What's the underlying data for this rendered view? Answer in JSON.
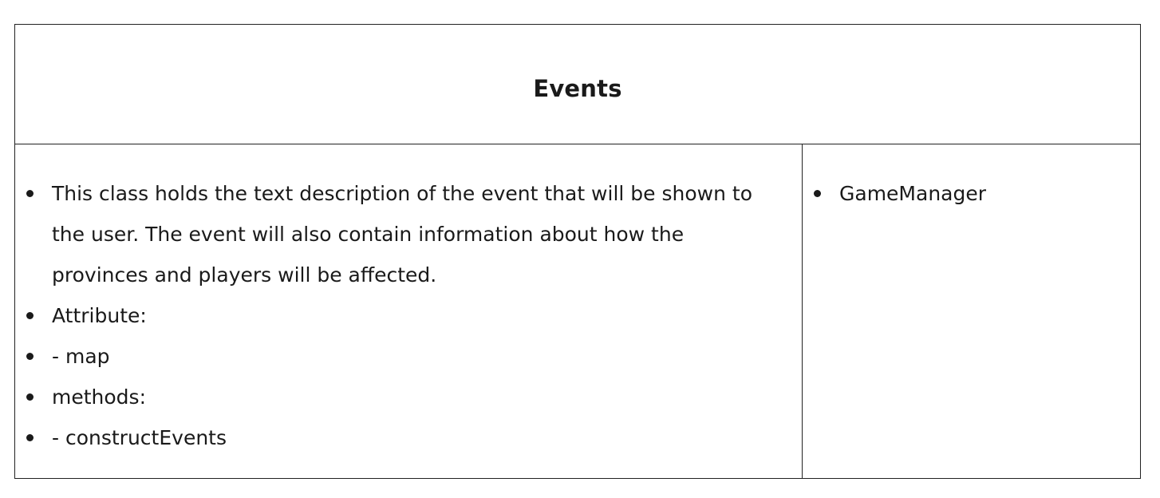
{
  "card": {
    "title": "Events",
    "responsibilities": [
      "This class holds the text description of the event that will be shown to the user. The event will also contain information about how the provinces and players will be affected.",
      "Attribute:",
      "- map",
      "methods:",
      "- constructEvents"
    ],
    "collaborators": [
      "GameManager"
    ]
  }
}
